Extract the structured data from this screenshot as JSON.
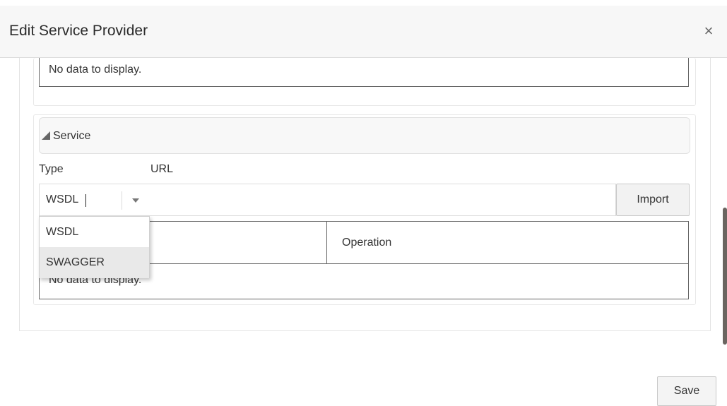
{
  "dialog": {
    "title": "Edit Service Provider",
    "close_glyph": "×"
  },
  "upper_table": {
    "empty_text": "No data to display."
  },
  "service": {
    "section_label": "Service",
    "type_label": "Type",
    "url_label": "URL",
    "type_value": "WSDL",
    "url_value": "",
    "import_label": "Import",
    "options": [
      "WSDL",
      "SWAGGER"
    ],
    "highlighted_option": "SWAGGER",
    "table": {
      "columns": [
        "",
        "Operation"
      ],
      "empty_text": "No data to display."
    }
  },
  "footer": {
    "save_label": "Save"
  },
  "icons": {
    "close": "close-icon",
    "collapse": "collapse-triangle-icon",
    "dropdown": "chevron-down-icon"
  }
}
